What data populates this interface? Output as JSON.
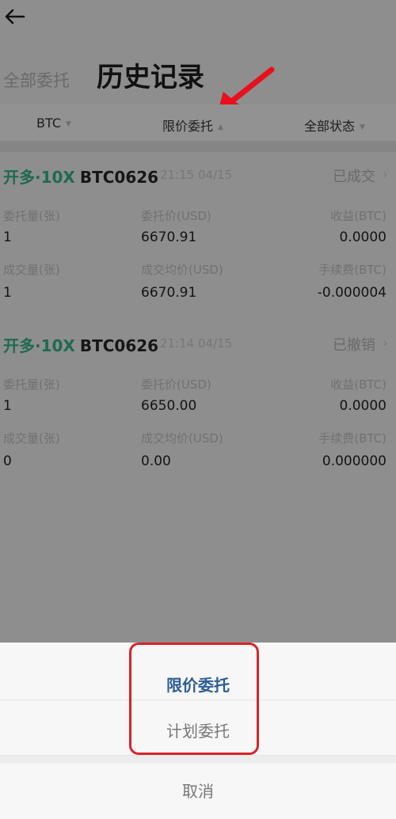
{
  "header": {
    "back_icon": "back-arrow-icon",
    "all_orders_label": "全部委托",
    "title": "历史记录"
  },
  "filters": [
    {
      "label": "BTC",
      "icon": "caret-down-icon"
    },
    {
      "label": "限价委托",
      "icon": "caret-up-icon"
    },
    {
      "label": "全部状态",
      "icon": "caret-down-icon"
    }
  ],
  "orders": [
    {
      "side": "开多·10X",
      "symbol": "BTC0626",
      "time": "21:15 04/15",
      "status": "已成交",
      "labels": {
        "qty": "委托量(张)",
        "price": "委托价(USD)",
        "profit": "收益(BTC)",
        "filled": "成交量(张)",
        "avg": "成交均价(USD)",
        "fee": "手续费(BTC)"
      },
      "values": {
        "qty": "1",
        "price": "6670.91",
        "profit": "0.0000",
        "filled": "1",
        "avg": "6670.91",
        "fee": "-0.000004"
      }
    },
    {
      "side": "开多·10X",
      "symbol": "BTC0626",
      "time": "21:14 04/15",
      "status": "已撤销",
      "labels": {
        "qty": "委托量(张)",
        "price": "委托价(USD)",
        "profit": "收益(BTC)",
        "filled": "成交量(张)",
        "avg": "成交均价(USD)",
        "fee": "手续费(BTC)"
      },
      "values": {
        "qty": "1",
        "price": "6650.00",
        "profit": "0.0000",
        "filled": "0",
        "avg": "0.00",
        "fee": "0.000000"
      }
    }
  ],
  "sheet": {
    "options": [
      "限价委托",
      "计划委托"
    ],
    "cancel": "取消"
  },
  "colors": {
    "side_green": "#1e6b4f",
    "selected_blue": "#2c5d96",
    "annotation_red": "#d8232a"
  }
}
